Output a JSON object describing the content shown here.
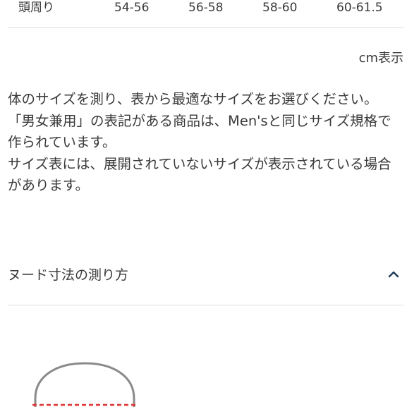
{
  "size_table": {
    "row_label": "頭周り",
    "values": [
      "54-56",
      "56-58",
      "58-60",
      "60-61.5"
    ]
  },
  "unit_note": "cm表示",
  "notes": [
    "体のサイズを測り、表から最適なサイズをお選びください。",
    "「男女兼用」の表記がある商品は、Men'sと同じサイズ規格で作られています。",
    "サイズ表には、展開されていないサイズが表示されている場合があります。"
  ],
  "accordion": {
    "title": "ヌード寸法の測り方",
    "icon": "chevron-up-icon",
    "expanded": true
  },
  "colors": {
    "text": "#3a3a3a",
    "divider": "#dddddd",
    "chevron": "#1f3a5a",
    "measure_line": "#e03030",
    "head_outline": "#8a8a8a"
  }
}
